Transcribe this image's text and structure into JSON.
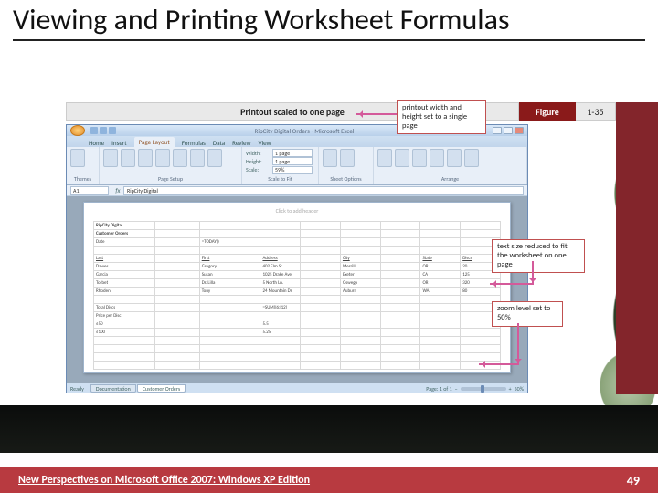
{
  "title": "Viewing and Printing Worksheet Formulas",
  "figure": {
    "caption": "Printout scaled to one page",
    "label": "Figure",
    "number": "1-35"
  },
  "excel": {
    "window_title": "RipCity Digital Orders - Microsoft Excel",
    "tabs": [
      "Home",
      "Insert",
      "Page Layout",
      "Formulas",
      "Data",
      "Review",
      "View"
    ],
    "ribbon_groups": {
      "themes": "Themes",
      "page_setup": "Page Setup",
      "page_setup_btns": [
        "Margins",
        "Orientation",
        "Size",
        "Print Area",
        "Breaks",
        "Background",
        "Print Titles"
      ],
      "scale_to_fit": "Scale to Fit",
      "width_label": "Width:",
      "width_value": "1 page",
      "height_label": "Height:",
      "height_value": "1 page",
      "scale_label": "Scale:",
      "scale_value": "59%",
      "sheet_options": "Sheet Options",
      "arrange": "Arrange"
    },
    "namebox": "A1",
    "formula_bar": "RipCity Digital",
    "page_header": "Click to add header",
    "worksheet": {
      "a1": "RipCity Digital",
      "a2": "Customer Orders",
      "rows": [
        [
          "Date",
          "",
          "=TODAY()",
          "",
          "",
          "",
          "",
          "",
          ""
        ],
        [
          "",
          "",
          "",
          "",
          "",
          "",
          "",
          "",
          ""
        ],
        [
          "Last",
          "",
          "First",
          "Address",
          "",
          "City",
          "",
          "State",
          "Discs"
        ],
        [
          "Dawes",
          "",
          "Gregory",
          "402 Elm St.",
          "",
          "Merrill",
          "",
          "OR",
          "20"
        ],
        [
          "Garcia",
          "",
          "Susan",
          "1025 Drake Ave.",
          "",
          "Exeter",
          "",
          "CA",
          "125"
        ],
        [
          "Torbet",
          "",
          "Dr. Lilla",
          "5 North Ln.",
          "",
          "Oswego",
          "",
          "OR",
          "320"
        ],
        [
          "Rhoden",
          "",
          "Tony",
          "24 Mountain Dr.",
          "",
          "Auburn",
          "",
          "WA",
          "80"
        ],
        [
          "",
          "",
          "",
          "",
          "",
          "",
          "",
          "",
          ""
        ],
        [
          "Total Discs",
          "",
          "",
          "=SUM(I6:I12)",
          "",
          "",
          "",
          "",
          ""
        ],
        [
          "Price per Disc",
          "",
          "",
          "",
          "",
          "",
          "",
          "",
          ""
        ],
        [
          "≤50",
          "",
          "",
          "5.5",
          "",
          "",
          "",
          "",
          ""
        ],
        [
          "≤100",
          "",
          "",
          "5.25",
          "",
          "",
          "",
          "",
          ""
        ]
      ]
    },
    "sheet_tabs": [
      "Documentation",
      "Customer Orders"
    ],
    "status_left": "Ready",
    "status_page": "Page: 1 of 1",
    "zoom_pct": "50%"
  },
  "callouts": {
    "c1": "printout width and height set to a single page",
    "c2": "text size reduced to fit the worksheet on one page",
    "c3": "zoom level set to 50%"
  },
  "footer": {
    "source": "New Perspectives on Microsoft Office 2007: Windows XP Edition",
    "page": "49"
  }
}
